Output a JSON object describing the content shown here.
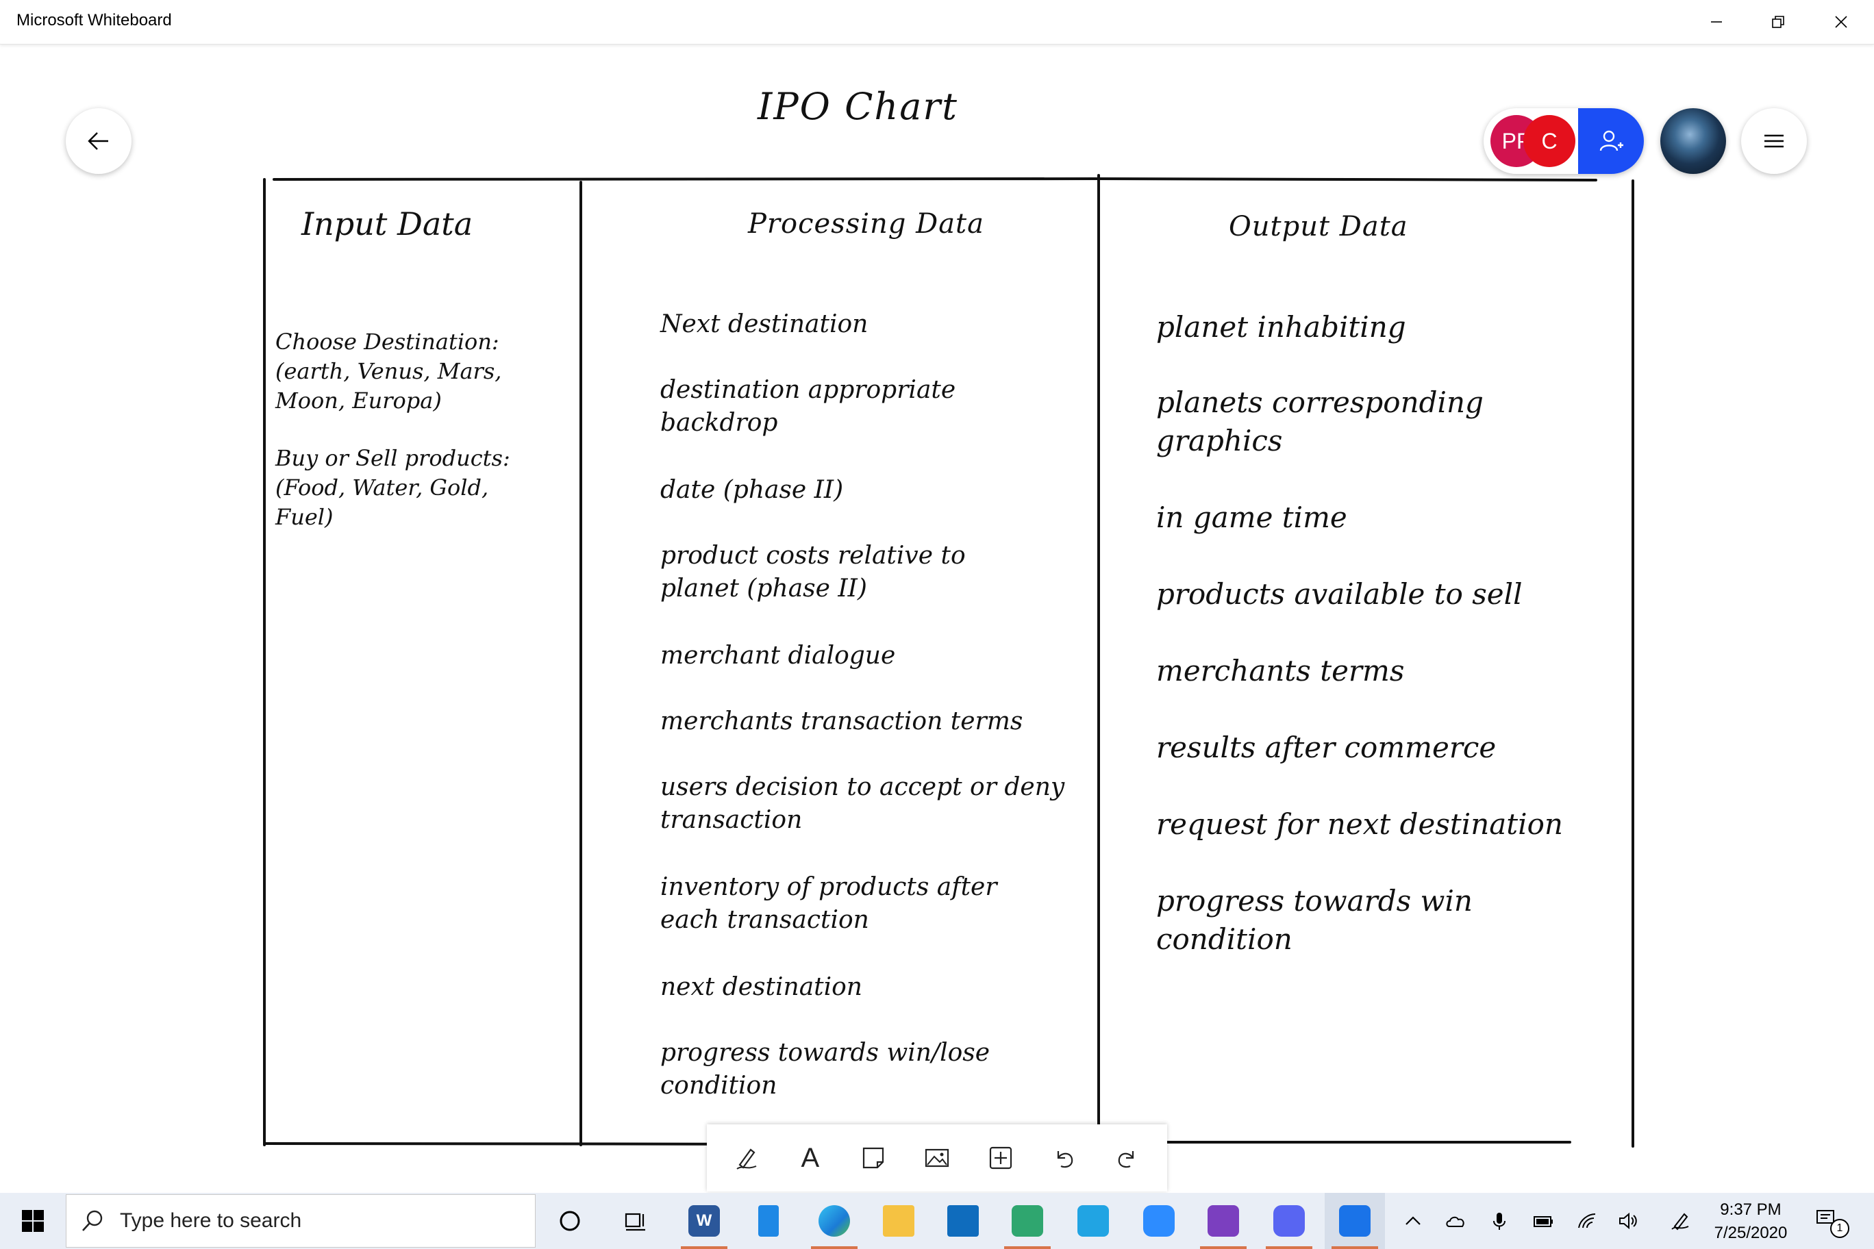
{
  "window": {
    "title": "Microsoft Whiteboard",
    "controls": [
      "minimize-icon",
      "restore-icon",
      "close-icon"
    ]
  },
  "whiteboard": {
    "chart_title": "IPO Chart",
    "presence": {
      "avatars": [
        "PP",
        "C"
      ],
      "colors": [
        "#d2134f",
        "#e4101c"
      ],
      "invite_color": "#1b4ef5"
    },
    "columns": {
      "input": {
        "heading": "Input Data",
        "items": [
          "Choose Destination:\n(earth, Venus, Mars,\nMoon, Europa)",
          "Buy or Sell products:\n(Food, Water, Gold,\nFuel)"
        ]
      },
      "processing": {
        "heading": "Processing Data",
        "items": [
          "Next destination",
          "destination appropriate\nbackdrop",
          "date (phase II)",
          "product costs relative to\nplanet (phase II)",
          "merchant dialogue",
          "merchants transaction terms",
          "users decision to accept or deny\ntransaction",
          "inventory of products after\neach transaction",
          "next destination",
          "progress towards win/lose\ncondition"
        ]
      },
      "output": {
        "heading": "Output  Data",
        "items": [
          "planet inhabiting",
          "planets corresponding\ngraphics",
          "in game time",
          "products available to sell",
          "merchants terms",
          "results after commerce",
          "request for next destination",
          "progress towards win\ncondition"
        ]
      }
    },
    "toolbar": {
      "tools": [
        "pen-icon",
        "text-icon",
        "sticky-note-icon",
        "image-icon",
        "insert-icon",
        "undo-icon",
        "redo-icon"
      ],
      "text_tool_label": "A"
    }
  },
  "taskbar": {
    "search_placeholder": "Type here to search",
    "word_label": "W",
    "time": "9:37 PM",
    "date": "7/25/2020",
    "notification_count": "1",
    "accent": "#1a73e8"
  }
}
